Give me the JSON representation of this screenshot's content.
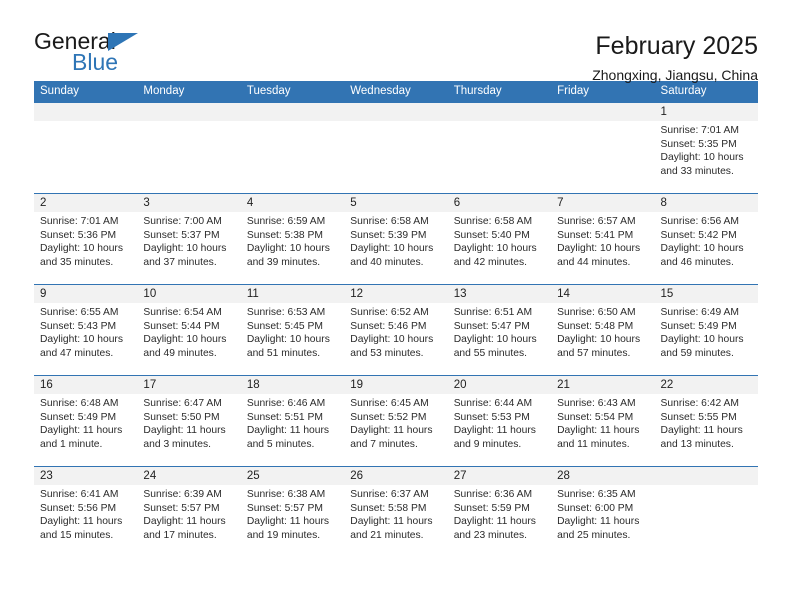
{
  "logo": {
    "word1": "General",
    "word2": "Blue",
    "triangle_color": "#2e75b6"
  },
  "header": {
    "title": "February 2025",
    "subtitle": "Zhongxing, Jiangsu, China",
    "accent_color": "#3274b3"
  },
  "weekdays": [
    "Sunday",
    "Monday",
    "Tuesday",
    "Wednesday",
    "Thursday",
    "Friday",
    "Saturday"
  ],
  "labels": {
    "sunrise": "Sunrise:",
    "sunset": "Sunset:",
    "daylight": "Daylight:"
  },
  "weeks": [
    [
      {
        "day": "",
        "empty": true
      },
      {
        "day": "",
        "empty": true
      },
      {
        "day": "",
        "empty": true
      },
      {
        "day": "",
        "empty": true
      },
      {
        "day": "",
        "empty": true
      },
      {
        "day": "",
        "empty": true
      },
      {
        "day": "1",
        "sunrise": "Sunrise: 7:01 AM",
        "sunset": "Sunset: 5:35 PM",
        "daylight1": "Daylight: 10 hours",
        "daylight2": "and 33 minutes."
      }
    ],
    [
      {
        "day": "2",
        "sunrise": "Sunrise: 7:01 AM",
        "sunset": "Sunset: 5:36 PM",
        "daylight1": "Daylight: 10 hours",
        "daylight2": "and 35 minutes."
      },
      {
        "day": "3",
        "sunrise": "Sunrise: 7:00 AM",
        "sunset": "Sunset: 5:37 PM",
        "daylight1": "Daylight: 10 hours",
        "daylight2": "and 37 minutes."
      },
      {
        "day": "4",
        "sunrise": "Sunrise: 6:59 AM",
        "sunset": "Sunset: 5:38 PM",
        "daylight1": "Daylight: 10 hours",
        "daylight2": "and 39 minutes."
      },
      {
        "day": "5",
        "sunrise": "Sunrise: 6:58 AM",
        "sunset": "Sunset: 5:39 PM",
        "daylight1": "Daylight: 10 hours",
        "daylight2": "and 40 minutes."
      },
      {
        "day": "6",
        "sunrise": "Sunrise: 6:58 AM",
        "sunset": "Sunset: 5:40 PM",
        "daylight1": "Daylight: 10 hours",
        "daylight2": "and 42 minutes."
      },
      {
        "day": "7",
        "sunrise": "Sunrise: 6:57 AM",
        "sunset": "Sunset: 5:41 PM",
        "daylight1": "Daylight: 10 hours",
        "daylight2": "and 44 minutes."
      },
      {
        "day": "8",
        "sunrise": "Sunrise: 6:56 AM",
        "sunset": "Sunset: 5:42 PM",
        "daylight1": "Daylight: 10 hours",
        "daylight2": "and 46 minutes."
      }
    ],
    [
      {
        "day": "9",
        "sunrise": "Sunrise: 6:55 AM",
        "sunset": "Sunset: 5:43 PM",
        "daylight1": "Daylight: 10 hours",
        "daylight2": "and 47 minutes."
      },
      {
        "day": "10",
        "sunrise": "Sunrise: 6:54 AM",
        "sunset": "Sunset: 5:44 PM",
        "daylight1": "Daylight: 10 hours",
        "daylight2": "and 49 minutes."
      },
      {
        "day": "11",
        "sunrise": "Sunrise: 6:53 AM",
        "sunset": "Sunset: 5:45 PM",
        "daylight1": "Daylight: 10 hours",
        "daylight2": "and 51 minutes."
      },
      {
        "day": "12",
        "sunrise": "Sunrise: 6:52 AM",
        "sunset": "Sunset: 5:46 PM",
        "daylight1": "Daylight: 10 hours",
        "daylight2": "and 53 minutes."
      },
      {
        "day": "13",
        "sunrise": "Sunrise: 6:51 AM",
        "sunset": "Sunset: 5:47 PM",
        "daylight1": "Daylight: 10 hours",
        "daylight2": "and 55 minutes."
      },
      {
        "day": "14",
        "sunrise": "Sunrise: 6:50 AM",
        "sunset": "Sunset: 5:48 PM",
        "daylight1": "Daylight: 10 hours",
        "daylight2": "and 57 minutes."
      },
      {
        "day": "15",
        "sunrise": "Sunrise: 6:49 AM",
        "sunset": "Sunset: 5:49 PM",
        "daylight1": "Daylight: 10 hours",
        "daylight2": "and 59 minutes."
      }
    ],
    [
      {
        "day": "16",
        "sunrise": "Sunrise: 6:48 AM",
        "sunset": "Sunset: 5:49 PM",
        "daylight1": "Daylight: 11 hours",
        "daylight2": "and 1 minute."
      },
      {
        "day": "17",
        "sunrise": "Sunrise: 6:47 AM",
        "sunset": "Sunset: 5:50 PM",
        "daylight1": "Daylight: 11 hours",
        "daylight2": "and 3 minutes."
      },
      {
        "day": "18",
        "sunrise": "Sunrise: 6:46 AM",
        "sunset": "Sunset: 5:51 PM",
        "daylight1": "Daylight: 11 hours",
        "daylight2": "and 5 minutes."
      },
      {
        "day": "19",
        "sunrise": "Sunrise: 6:45 AM",
        "sunset": "Sunset: 5:52 PM",
        "daylight1": "Daylight: 11 hours",
        "daylight2": "and 7 minutes."
      },
      {
        "day": "20",
        "sunrise": "Sunrise: 6:44 AM",
        "sunset": "Sunset: 5:53 PM",
        "daylight1": "Daylight: 11 hours",
        "daylight2": "and 9 minutes."
      },
      {
        "day": "21",
        "sunrise": "Sunrise: 6:43 AM",
        "sunset": "Sunset: 5:54 PM",
        "daylight1": "Daylight: 11 hours",
        "daylight2": "and 11 minutes."
      },
      {
        "day": "22",
        "sunrise": "Sunrise: 6:42 AM",
        "sunset": "Sunset: 5:55 PM",
        "daylight1": "Daylight: 11 hours",
        "daylight2": "and 13 minutes."
      }
    ],
    [
      {
        "day": "23",
        "sunrise": "Sunrise: 6:41 AM",
        "sunset": "Sunset: 5:56 PM",
        "daylight1": "Daylight: 11 hours",
        "daylight2": "and 15 minutes."
      },
      {
        "day": "24",
        "sunrise": "Sunrise: 6:39 AM",
        "sunset": "Sunset: 5:57 PM",
        "daylight1": "Daylight: 11 hours",
        "daylight2": "and 17 minutes."
      },
      {
        "day": "25",
        "sunrise": "Sunrise: 6:38 AM",
        "sunset": "Sunset: 5:57 PM",
        "daylight1": "Daylight: 11 hours",
        "daylight2": "and 19 minutes."
      },
      {
        "day": "26",
        "sunrise": "Sunrise: 6:37 AM",
        "sunset": "Sunset: 5:58 PM",
        "daylight1": "Daylight: 11 hours",
        "daylight2": "and 21 minutes."
      },
      {
        "day": "27",
        "sunrise": "Sunrise: 6:36 AM",
        "sunset": "Sunset: 5:59 PM",
        "daylight1": "Daylight: 11 hours",
        "daylight2": "and 23 minutes."
      },
      {
        "day": "28",
        "sunrise": "Sunrise: 6:35 AM",
        "sunset": "Sunset: 6:00 PM",
        "daylight1": "Daylight: 11 hours",
        "daylight2": "and 25 minutes."
      },
      {
        "day": "",
        "empty": true
      }
    ]
  ]
}
